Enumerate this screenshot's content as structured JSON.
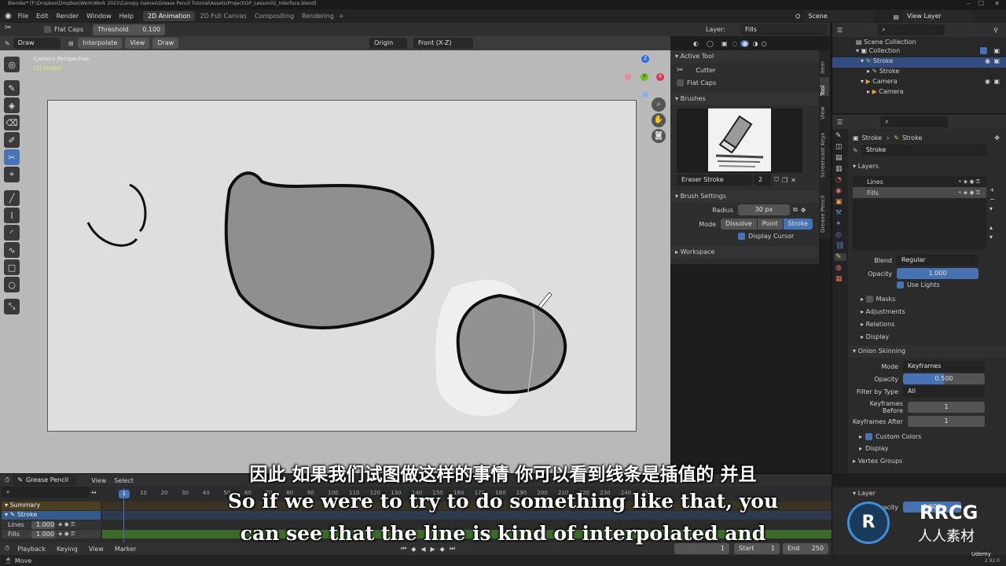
{
  "title_bar": {
    "text": "Blender* [F:\\Dropbox\\Dropbox\\Work\\Work 2021\\Canopy Games\\Grease Pencil Tutorial\\Assets\\Project\\GP_Lesson02_Interface.blend]"
  },
  "menu": {
    "items": [
      "File",
      "Edit",
      "Render",
      "Window",
      "Help"
    ]
  },
  "workspace_tabs": [
    "2D Animation",
    "2D Full Canvas",
    "Compositing",
    "Rendering"
  ],
  "workspace_add": "+",
  "scene": {
    "label": "Scene",
    "view_layer": "View Layer"
  },
  "tool_settings": {
    "flat_caps": "Flat Caps",
    "threshold_label": "Threshold",
    "threshold_value": "0.100",
    "layer_label": "Layer:",
    "layer_value": "Fills"
  },
  "viewport_header": {
    "mode": "Draw",
    "interpolate": "Interpolate",
    "view": "View",
    "draw": "Draw",
    "origin": "Origin",
    "orientation": "Front (X-Z)"
  },
  "viewport": {
    "camera_label": "Camera Perspective",
    "object_label": "(1) Stroke",
    "gizmo": {
      "z": "Z",
      "y": "Y",
      "x": "X"
    }
  },
  "npanel": {
    "tabs": [
      "Item",
      "Tool",
      "View",
      "Screencast Keys",
      "Grease Pencil"
    ],
    "active_tool": {
      "header": "Active Tool",
      "name": "Cutter",
      "flat_caps": "Flat Caps"
    },
    "brushes": {
      "header": "Brushes",
      "brush_name": "Eraser Stroke",
      "users": "2"
    },
    "brush_settings": {
      "header": "Brush Settings",
      "radius_label": "Radius",
      "radius_value": "30 px",
      "mode_label": "Mode",
      "modes": [
        "Dissolve",
        "Point",
        "Stroke"
      ],
      "active_mode": "Stroke",
      "display_cursor": "Display Cursor"
    },
    "workspace": {
      "header": "Workspace"
    }
  },
  "outliner": {
    "search": "",
    "items": [
      {
        "label": "Scene Collection",
        "depth": 0
      },
      {
        "label": "Collection",
        "depth": 1
      },
      {
        "label": "Stroke",
        "depth": 2
      },
      {
        "label": "Stroke",
        "depth": 3
      },
      {
        "label": "Camera",
        "depth": 2
      },
      {
        "label": "Camera",
        "depth": 3
      }
    ]
  },
  "properties": {
    "breadcrumb": [
      "Stroke",
      "Stroke"
    ],
    "data_name": "Stroke",
    "layers_header": "Layers",
    "layers": [
      {
        "name": "Lines"
      },
      {
        "name": "Fills"
      }
    ],
    "blend_label": "Blend",
    "blend_value": "Regular",
    "opacity_label": "Opacity",
    "opacity_value": "1.000",
    "use_lights": "Use Lights",
    "sections": [
      "Masks",
      "Adjustments",
      "Relations",
      "Display"
    ],
    "onion": {
      "header": "Onion Skinning",
      "mode_label": "Mode",
      "mode_value": "Keyframes",
      "opacity_label": "Opacity",
      "opacity_value": "0.500",
      "filter_label": "Filter by Type",
      "filter_value": "All",
      "before_label": "Keyframes Before",
      "before_value": "1",
      "after_label": "Keyframes After",
      "after_value": "1",
      "custom_colors": "Custom Colors",
      "display": "Display"
    },
    "vertex_groups": "Vertex Groups",
    "layer_bottom": "Layer",
    "opacity_bottom_label": "Opacity",
    "opacity_bottom_value": "1.000"
  },
  "timeline": {
    "mode": "Grease Pencil",
    "menu": [
      "View",
      "Select"
    ],
    "frames": [
      "1",
      "10",
      "20",
      "30",
      "40",
      "50",
      "60",
      "70",
      "80",
      "90",
      "100",
      "110",
      "120",
      "130",
      "140",
      "150",
      "160",
      "170",
      "180",
      "190",
      "200",
      "210",
      "220",
      "230",
      "240",
      "250"
    ],
    "current_frame": "1",
    "summary": "Summary",
    "stroke": "Stroke",
    "layers": [
      {
        "name": "Lines",
        "value": "1.000"
      },
      {
        "name": "Fills",
        "value": "1.000"
      }
    ],
    "footer": [
      "Playback",
      "Keying",
      "View",
      "Marker"
    ],
    "frame_field": "1",
    "start_label": "Start",
    "start_value": "1",
    "end_label": "End",
    "end_value": "250"
  },
  "status_bar": {
    "left": "Move",
    "version": "2.92.0"
  },
  "subtitles": {
    "cn": "因此 如果我们试图做这样的事情 你可以看到线条是插值的 并且",
    "en1": "So if we were to try to do something like that, you",
    "en2": "can see that the line is kind of interpolated and"
  },
  "watermarks": {
    "logo_text": "RRCG",
    "logo_sub": "人人素材",
    "udemy": "Udemy"
  },
  "colors": {
    "accent": "#4772b3",
    "canvas": "#dedede",
    "viewport_bg": "#b8b8b8"
  }
}
